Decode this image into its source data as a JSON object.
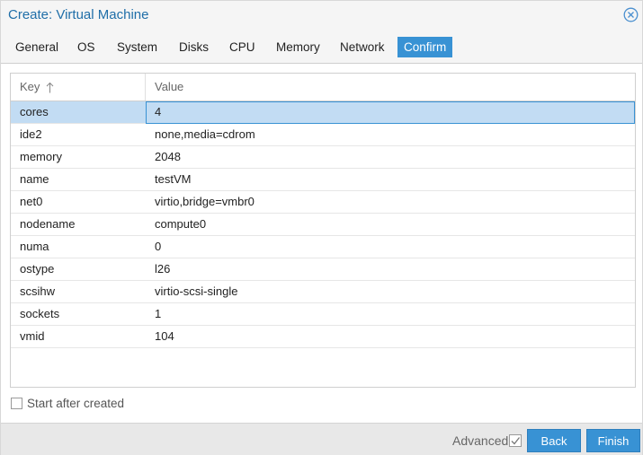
{
  "window": {
    "title": "Create: Virtual Machine",
    "close_icon": "close-circle-icon"
  },
  "tabs": [
    {
      "label": "General",
      "active": false
    },
    {
      "label": "OS",
      "active": false
    },
    {
      "label": "System",
      "active": false
    },
    {
      "label": "Disks",
      "active": false
    },
    {
      "label": "CPU",
      "active": false
    },
    {
      "label": "Memory",
      "active": false
    },
    {
      "label": "Network",
      "active": false
    },
    {
      "label": "Confirm",
      "active": true
    }
  ],
  "grid": {
    "columns": {
      "key": "Key",
      "value": "Value"
    },
    "sort_icon": "arrow-up-icon",
    "rows": [
      {
        "key": "cores",
        "value": "4"
      },
      {
        "key": "ide2",
        "value": "none,media=cdrom"
      },
      {
        "key": "memory",
        "value": "2048"
      },
      {
        "key": "name",
        "value": "testVM"
      },
      {
        "key": "net0",
        "value": "virtio,bridge=vmbr0"
      },
      {
        "key": "nodename",
        "value": "compute0"
      },
      {
        "key": "numa",
        "value": "0"
      },
      {
        "key": "ostype",
        "value": "l26"
      },
      {
        "key": "scsihw",
        "value": "virtio-scsi-single"
      },
      {
        "key": "sockets",
        "value": "1"
      },
      {
        "key": "vmid",
        "value": "104"
      }
    ],
    "selected_row": 0
  },
  "start_after_created": {
    "label": "Start after created",
    "checked": false
  },
  "bottom": {
    "advanced_label": "Advanced",
    "advanced_checked": true,
    "back_label": "Back",
    "finish_label": "Finish"
  },
  "colors": {
    "accent": "#3892d4",
    "title": "#1f6ea8",
    "selected_row": "#c2dcf3"
  }
}
